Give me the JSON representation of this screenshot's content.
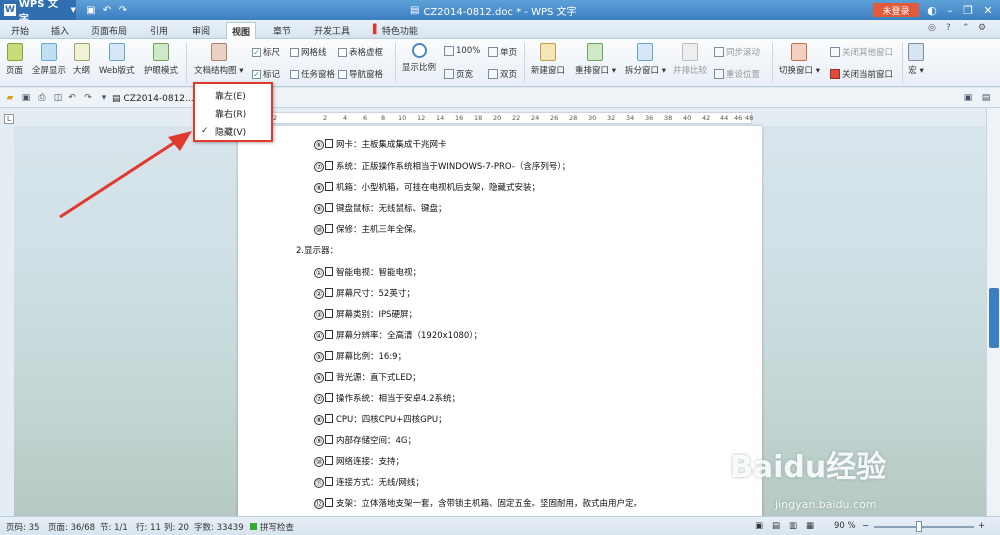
{
  "title_bar": {
    "app_name": "WPS 文字",
    "document_title": "CZ2014-0812.doc * - WPS 文字",
    "login_label": "未登录"
  },
  "menu": {
    "items": [
      "开始",
      "插入",
      "页面布局",
      "引用",
      "审阅",
      "视图",
      "章节",
      "开发工具",
      "特色功能"
    ],
    "active": "视图"
  },
  "ribbon": {
    "page_view": "页面",
    "full_screen": "全屏显示",
    "outline": "大纲",
    "web_layout": "Web版式",
    "reading_mode": "护眼模式",
    "doc_structure": "文档结构图",
    "ruler": "标尺",
    "gridlines": "网格线",
    "table_borders": "表格虚框",
    "marks": "标记",
    "task_pane": "任务窗格",
    "nav_pane": "导航窗格",
    "zoom": "显示比例",
    "zoom_100": "100%",
    "page_width": "页宽",
    "single_page": "单页",
    "two_pages": "双页",
    "new_window": "新建窗口",
    "arrange_windows": "重排窗口",
    "split_window": "拆分窗口",
    "side_by_side": "并排比较",
    "sync_scroll": "同步滚动",
    "reset_position": "重设位置",
    "switch_window": "切换窗口",
    "close_other": "关闭其他窗口",
    "close_current": "关闭当前窗口",
    "macro": "宏"
  },
  "toolbar": {
    "doc_tab": "CZ2014-0812..."
  },
  "ruler_ticks": [
    "2",
    "2",
    "4",
    "6",
    "8",
    "10",
    "12",
    "14",
    "16",
    "18",
    "20",
    "22",
    "24",
    "26",
    "28",
    "30",
    "32",
    "34",
    "36",
    "38",
    "40",
    "42",
    "44",
    "46",
    "48"
  ],
  "dropdown": {
    "items": [
      {
        "label": "靠左(E)",
        "checked": false
      },
      {
        "label": "靠右(R)",
        "checked": false
      },
      {
        "label": "隐藏(V)",
        "checked": true
      }
    ]
  },
  "document": {
    "group1": [
      {
        "num": "⑥",
        "text": "网卡：主板集成集成千兆网卡"
      },
      {
        "num": "⑦",
        "text": "系统：正版操作系统相当于WINDOWS-7-PRO-（含序列号）；"
      },
      {
        "num": "⑧",
        "text": "机箱：小型机箱，可挂在电视机后支架，隐藏式安装；"
      },
      {
        "num": "⑨",
        "text": "键盘鼠标：无线鼠标、键盘；"
      },
      {
        "num": "⑩",
        "text": "保修：主机三年全保。"
      }
    ],
    "section2": "2.显示器：",
    "group2": [
      {
        "num": "①",
        "text": "智能电视：智能电视；"
      },
      {
        "num": "②",
        "text": "屏幕尺寸：52英寸；"
      },
      {
        "num": "③",
        "text": "屏幕类别：IPS硬屏；"
      },
      {
        "num": "④",
        "text": "屏幕分辨率：全高清（1920x1080）；"
      },
      {
        "num": "⑤",
        "text": "屏幕比例：16:9；"
      },
      {
        "num": "⑥",
        "text": "背光源：直下式LED；"
      },
      {
        "num": "⑦",
        "text": "操作系统：相当于安卓4.2系统；"
      },
      {
        "num": "⑧",
        "text": "CPU：四核CPU+四核GPU；"
      },
      {
        "num": "⑨",
        "text": "内部存储空间：4G；"
      },
      {
        "num": "⑩",
        "text": "网络连接：支持；"
      },
      {
        "num": "⑪",
        "text": "连接方式：无线/网线；"
      },
      {
        "num": "⑫",
        "text": "支架：立体落地支架一套，含带锁主机箱、固定五金。坚固耐用，款式由用户定。"
      }
    ]
  },
  "status": {
    "page_num": "页码: 35",
    "pages": "页面: 36/68",
    "section": "节: 1/1",
    "row": "行: 11",
    "col": "列: 20",
    "word_count": "字数: 33439",
    "spell_check": "拼写检查",
    "zoom": "90 %"
  },
  "watermark": {
    "brand": "Baidu经验",
    "url": "jingyan.baidu.com"
  },
  "colors": {
    "accent": "#3c7fc0",
    "annotation": "#e03a2f"
  }
}
